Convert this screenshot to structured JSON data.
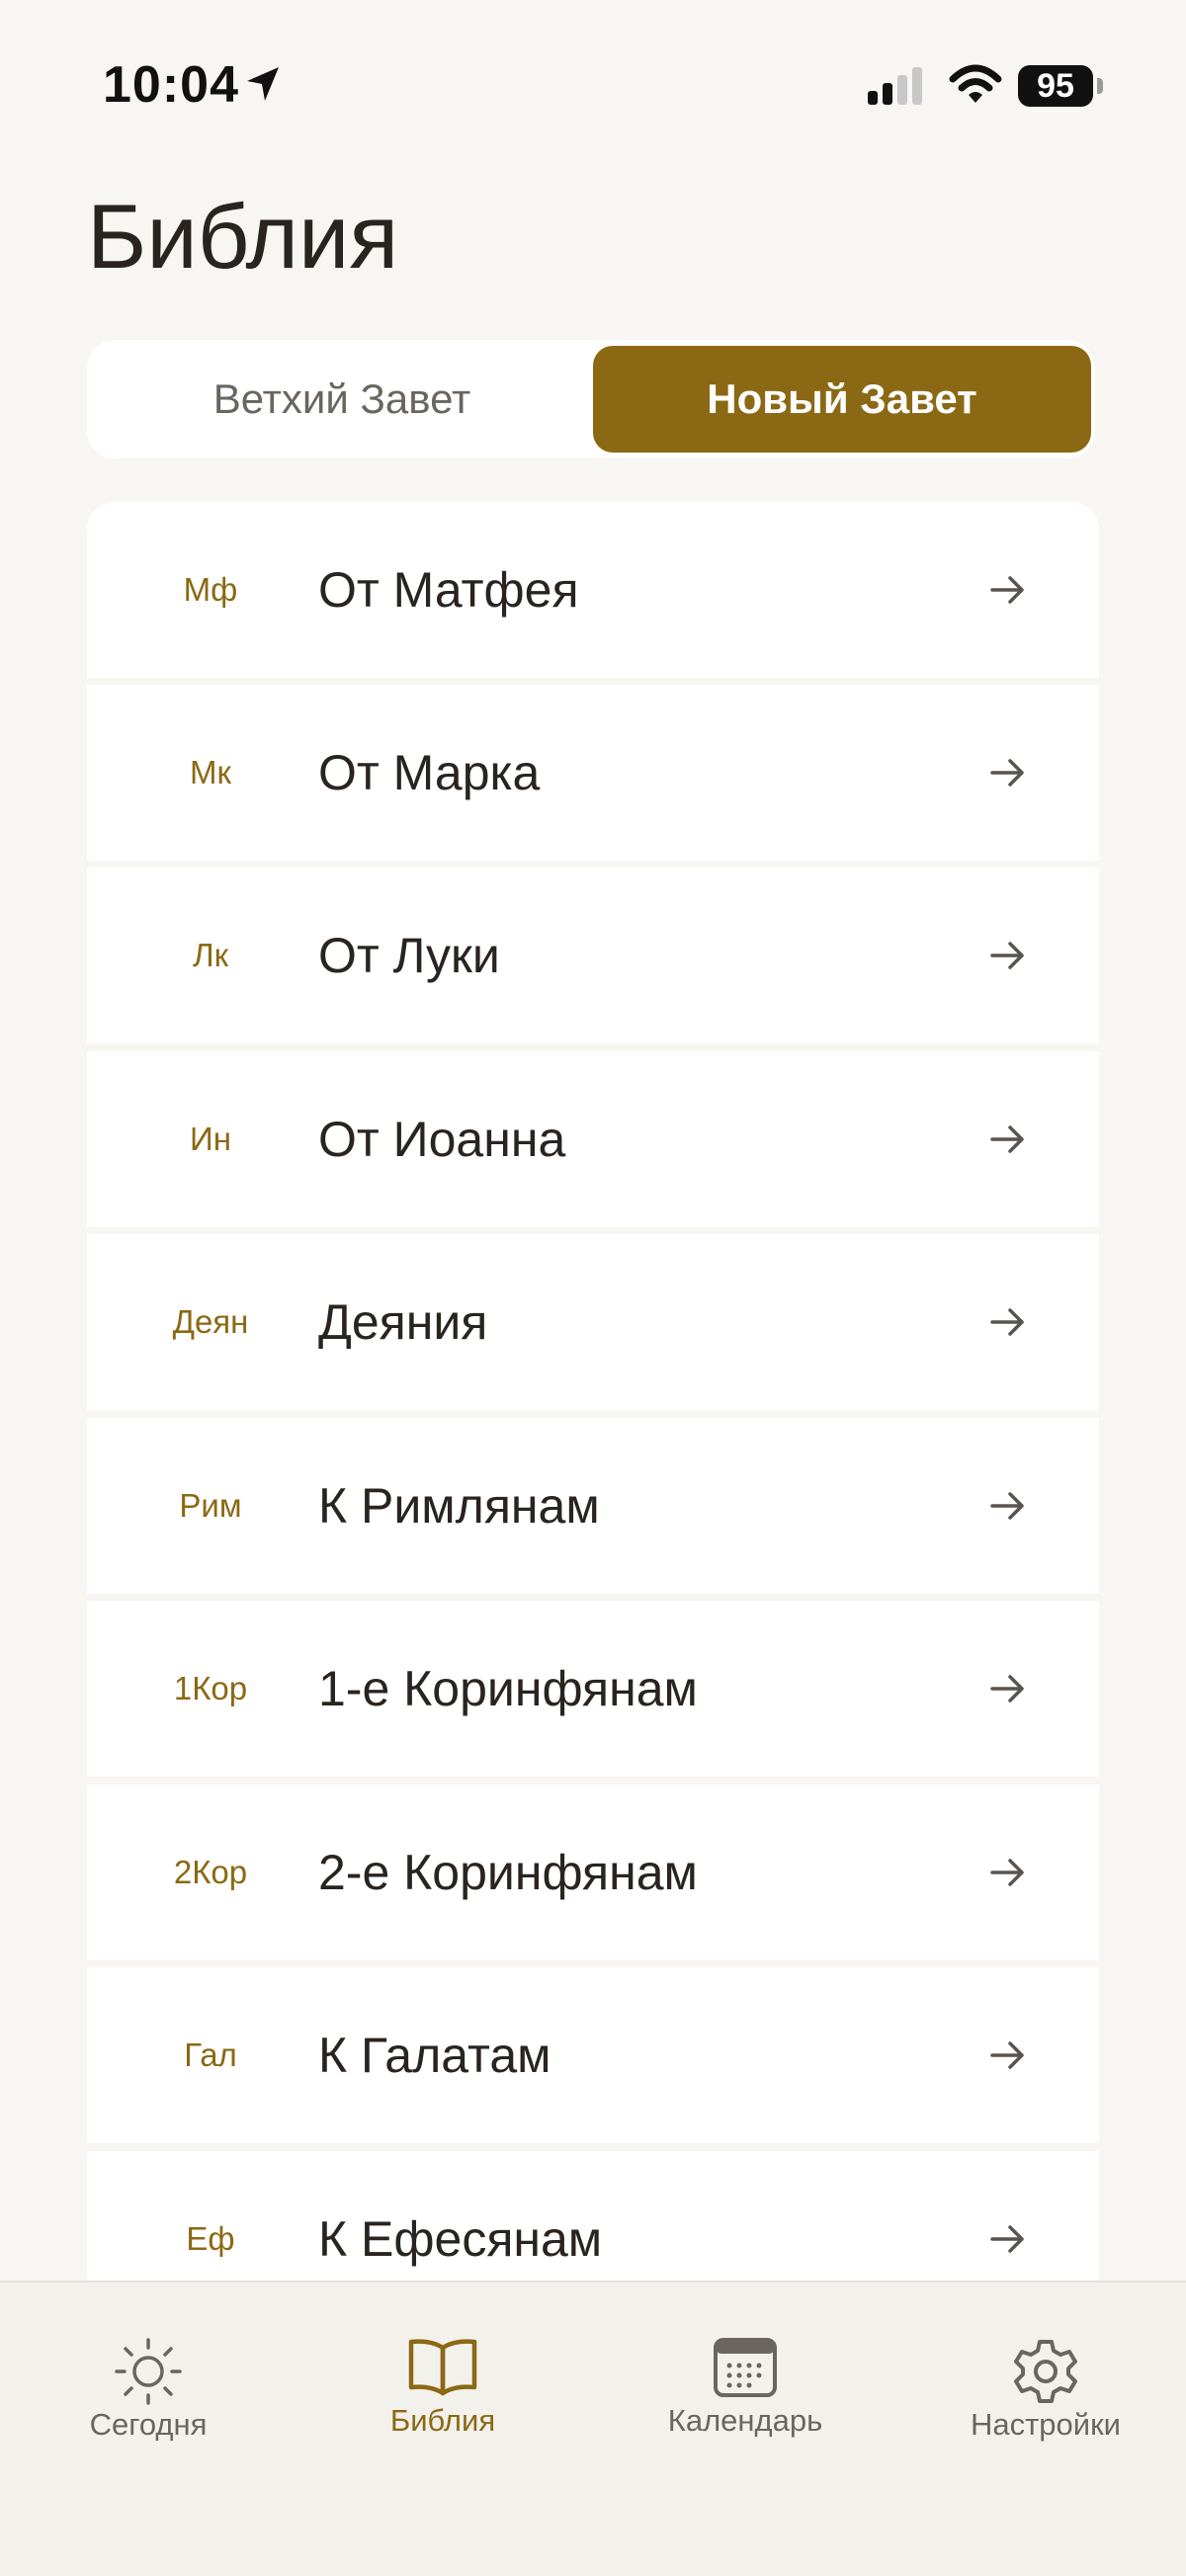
{
  "status_bar": {
    "time": "10:04",
    "battery": "95"
  },
  "page": {
    "title": "Библия"
  },
  "testament_toggle": {
    "old_label": "Ветхий Завет",
    "new_label": "Новый Завет",
    "selected": "new"
  },
  "books": [
    {
      "abbr": "Мф",
      "name": "От Матфея"
    },
    {
      "abbr": "Мк",
      "name": "От Марка"
    },
    {
      "abbr": "Лк",
      "name": "От Луки"
    },
    {
      "abbr": "Ин",
      "name": "От Иоанна"
    },
    {
      "abbr": "Деян",
      "name": "Деяния"
    },
    {
      "abbr": "Рим",
      "name": "К Римлянам"
    },
    {
      "abbr": "1Кор",
      "name": "1-е Коринфянам"
    },
    {
      "abbr": "2Кор",
      "name": "2-е Коринфянам"
    },
    {
      "abbr": "Гал",
      "name": "К Галатам"
    },
    {
      "abbr": "Еф",
      "name": "К Ефесянам"
    }
  ],
  "tab_bar": {
    "tabs": [
      {
        "label": "Сегодня",
        "icon": "sun-icon"
      },
      {
        "label": "Библия",
        "icon": "book-icon",
        "active": true
      },
      {
        "label": "Календарь",
        "icon": "calendar-icon"
      },
      {
        "label": "Настройки",
        "icon": "gear-icon"
      }
    ]
  },
  "colors": {
    "accent": "#8b6914",
    "background": "#f8f6f2",
    "text": "#2a2420"
  }
}
